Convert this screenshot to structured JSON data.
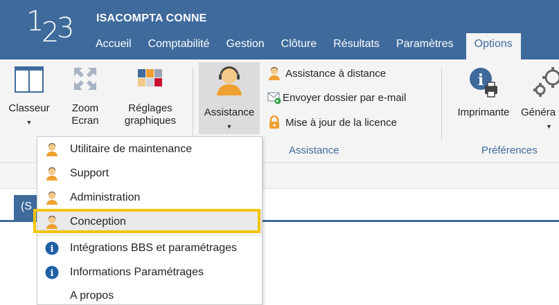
{
  "app": {
    "logo": {
      "d1": "1",
      "d2": "2",
      "d3": "3"
    },
    "title": "ISACOMPTA CONNE"
  },
  "tabs": [
    {
      "label": "Accueil"
    },
    {
      "label": "Comptabilité"
    },
    {
      "label": "Gestion"
    },
    {
      "label": "Clôture"
    },
    {
      "label": "Résultats"
    },
    {
      "label": "Paramètres"
    },
    {
      "label": "Options",
      "active": true
    }
  ],
  "ribbon": {
    "classeur": "Classeur",
    "zoom_line1": "Zoom",
    "zoom_line2": "Ecran",
    "reglages_line1": "Réglages",
    "reglages_line2": "graphiques",
    "assistance": "Assistance",
    "assistance_distance": "Assistance à distance",
    "envoyer_dossier": "Envoyer dossier par e-mail",
    "mise_a_jour": "Mise à jour de la licence",
    "group_assistance": "Assistance",
    "imprimante": "Imprimante",
    "general": "Généra",
    "group_preferences": "Préférences"
  },
  "doc_tab": {
    "label": "(S"
  },
  "menu": {
    "items": [
      {
        "label": "Utilitaire de maintenance",
        "icon": "support-person-icon"
      },
      {
        "label": "Support",
        "icon": "support-person-icon"
      },
      {
        "label": "Administration",
        "icon": "support-person-icon"
      },
      {
        "label": "Conception",
        "icon": "support-person-icon"
      },
      {
        "label": "Intégrations BBS et paramétrages",
        "icon": "info-icon"
      },
      {
        "label": "Informations Paramétrages",
        "icon": "info-icon"
      },
      {
        "label": "A propos",
        "icon": ""
      }
    ]
  },
  "colors": {
    "brand_blue": "#3e6a9c",
    "ribbon_bg": "#f4f4f4",
    "highlight": "#f2c40c",
    "person_orange": "#f0a030",
    "info_blue": "#1f5fa8"
  }
}
